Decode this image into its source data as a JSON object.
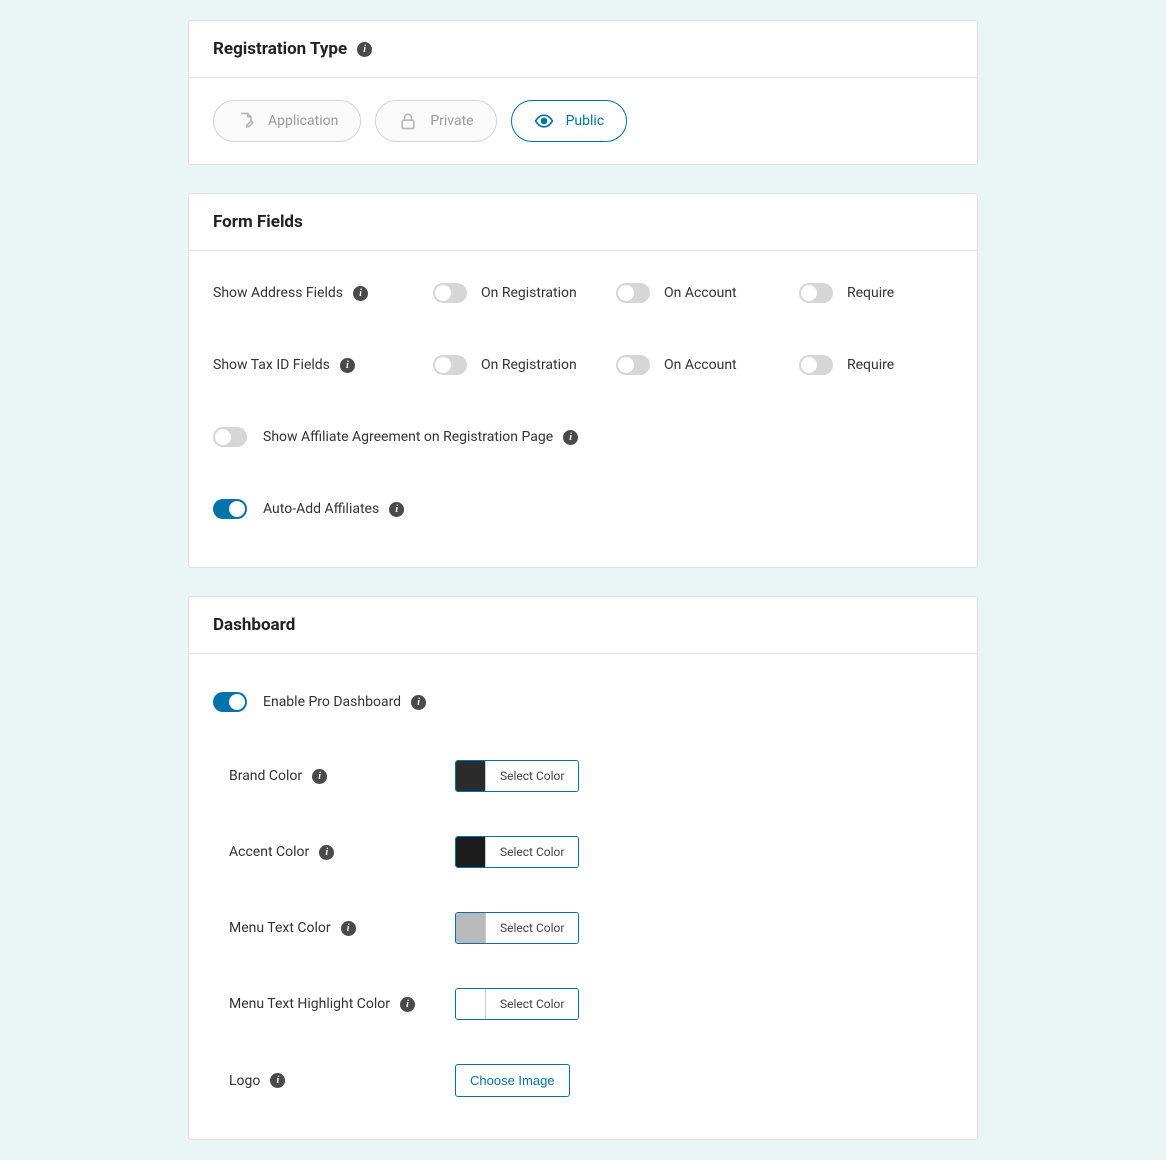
{
  "registration_type": {
    "title": "Registration Type",
    "options": {
      "application": "Application",
      "private": "Private",
      "public": "Public"
    },
    "selected": "public"
  },
  "form_fields": {
    "title": "Form Fields",
    "address": {
      "label": "Show Address Fields",
      "on_registration": {
        "label": "On Registration",
        "value": false
      },
      "on_account": {
        "label": "On Account",
        "value": false
      },
      "require": {
        "label": "Require",
        "value": false
      }
    },
    "tax_id": {
      "label": "Show Tax ID Fields",
      "on_registration": {
        "label": "On Registration",
        "value": false
      },
      "on_account": {
        "label": "On Account",
        "value": false
      },
      "require": {
        "label": "Require",
        "value": false
      }
    },
    "agreement": {
      "label": "Show Affiliate Agreement on Registration Page",
      "value": false
    },
    "auto_add": {
      "label": "Auto-Add Affiliates",
      "value": true
    }
  },
  "dashboard": {
    "title": "Dashboard",
    "enable": {
      "label": "Enable Pro Dashboard",
      "value": true
    },
    "select_color_label": "Select Color",
    "brand_color": {
      "label": "Brand Color",
      "value": "#2b2b2b"
    },
    "accent_color": {
      "label": "Accent Color",
      "value": "#1c1c1c"
    },
    "menu_text_color": {
      "label": "Menu Text Color",
      "value": "#b9b9b9"
    },
    "menu_text_highlight_color": {
      "label": "Menu Text Highlight Color",
      "value": "#ffffff"
    },
    "logo": {
      "label": "Logo",
      "button": "Choose Image"
    }
  }
}
